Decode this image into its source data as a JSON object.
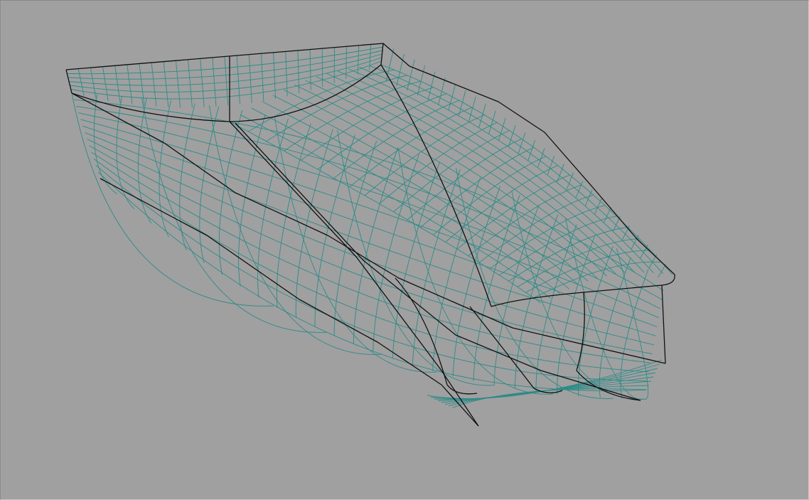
{
  "viewport": {
    "name": "3d-hull-wireframe-view",
    "background_color": "#a0a0a0"
  },
  "model": {
    "type": "boat-hull",
    "render_mode": "wireframe",
    "mesh_color": "#2e8b88",
    "outline_color": "#101010"
  }
}
